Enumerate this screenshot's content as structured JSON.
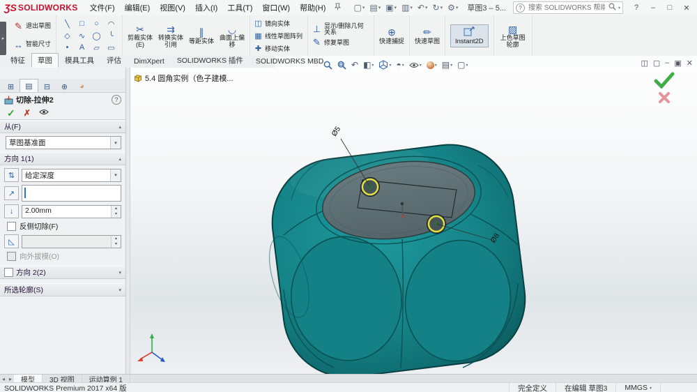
{
  "app": {
    "logo_ds": "ƷS",
    "logo_text": "SOLIDWORKS",
    "menus": [
      "文件(F)",
      "编辑(E)",
      "视图(V)",
      "插入(I)",
      "工具(T)",
      "窗口(W)",
      "帮助(H)"
    ],
    "doc_title": "草图3 – 5...",
    "search_placeholder": "搜索 SOLIDWORKS 帮助"
  },
  "ribbon": {
    "exit_sketch": "退出草图",
    "smart_dimension": "智能尺寸",
    "trim": "剪裁实体(E)",
    "convert": "转换实体引用",
    "offset": "等距实体",
    "offset_surface": "曲面上偏移",
    "mirror": "镜向实体",
    "linear_pattern": "线性草图阵列",
    "move": "移动实体",
    "relations": "显示/删除几何关系",
    "repair": "修复草图",
    "quick_snaps": "快速捕捉",
    "rapid_sketch": "快速草图",
    "instant2d": "Instant2D",
    "shaded_contours": "上色草图轮廓"
  },
  "command_tabs": {
    "items": [
      "特征",
      "草图",
      "模具工具",
      "评估",
      "DimXpert",
      "SOLIDWORKS 插件",
      "SOLIDWORKS MBD"
    ],
    "active": "草图"
  },
  "property_manager": {
    "title": "切除-拉伸2",
    "help": "?",
    "from_label": "从(F)",
    "from_value": "草图基准面",
    "dir1_label": "方向 1(1)",
    "dir1_condition": "给定深度",
    "dir1_depth": "2.00mm",
    "flip_side": "反侧切除(F)",
    "draft_value": "",
    "draft_outward": "向外拔模(O)",
    "dir2_label": "方向 2(2)",
    "contours_label": "所选轮廓(S)"
  },
  "graphics": {
    "breadcrumb": "5.4 圆角实例（色子建模...",
    "dim1": "Ø5",
    "dim2": "Ø8"
  },
  "doc_tabs": {
    "items": [
      "模型",
      "3D 视图",
      "运动算例 1"
    ],
    "active": "模型"
  },
  "status": {
    "product": "SOLIDWORKS Premium 2017 x64 版",
    "state": "完全定义",
    "editing": "在编辑 草图3",
    "units": "MMGS"
  },
  "colors": {
    "accent_red": "#c8102e",
    "dice_teal": "#158488",
    "dice_dark": "#0a5254",
    "top_face_gray": "#5f7073",
    "sketch_yellow": "#e2df3d",
    "check_green": "#3fae49",
    "cross_red": "#e59398"
  },
  "icons": {
    "new_doc": "▢",
    "open_doc": "▤",
    "save": "▣",
    "print": "▥",
    "undo": "↶",
    "rebuild": "↻",
    "options": "⚙",
    "help": "?",
    "win_min": "–",
    "win_restore": "□",
    "win_close": "✕",
    "caret": "▾",
    "chev_up": "▴",
    "chev_down": "▾",
    "exit_sketch": "✎",
    "smart_dim": "↔",
    "line": "╲",
    "rect": "□",
    "circle": "○",
    "arc": "◠",
    "polygon": "◇",
    "spline": "∿",
    "ellipse": "◯",
    "fillet": "╰",
    "point": "•",
    "text_tool": "A",
    "plane": "▱",
    "slot": "▭",
    "trim": "✂",
    "convert": "⇉",
    "offset": "∥",
    "offset_surface": "◡",
    "mirror": "◫",
    "pattern": "▦",
    "move": "✚",
    "relations": "⊥",
    "repair": "✎",
    "snaps": "⊕",
    "rapid": "✏",
    "shaded": "▨",
    "prev_view": "↶",
    "section": "◧",
    "display_style": "◓",
    "scene": "▤",
    "view_settings": "▢",
    "pane1": "◫",
    "pane2": "▢",
    "pane3": "–",
    "pane4": "▣",
    "pane5": "✕",
    "pm_tab1": "⊞",
    "pm_tab2": "▤",
    "pm_tab3": "⊟",
    "pm_tab4": "⊕",
    "pm_tab5": "◕",
    "updown": "⇅",
    "dir": "↗",
    "depth": "↓",
    "draft": "◺",
    "check": "✓",
    "cross": "✗",
    "tabnav_l": "◂",
    "tabnav_r": "▸",
    "flyout": "▸"
  }
}
